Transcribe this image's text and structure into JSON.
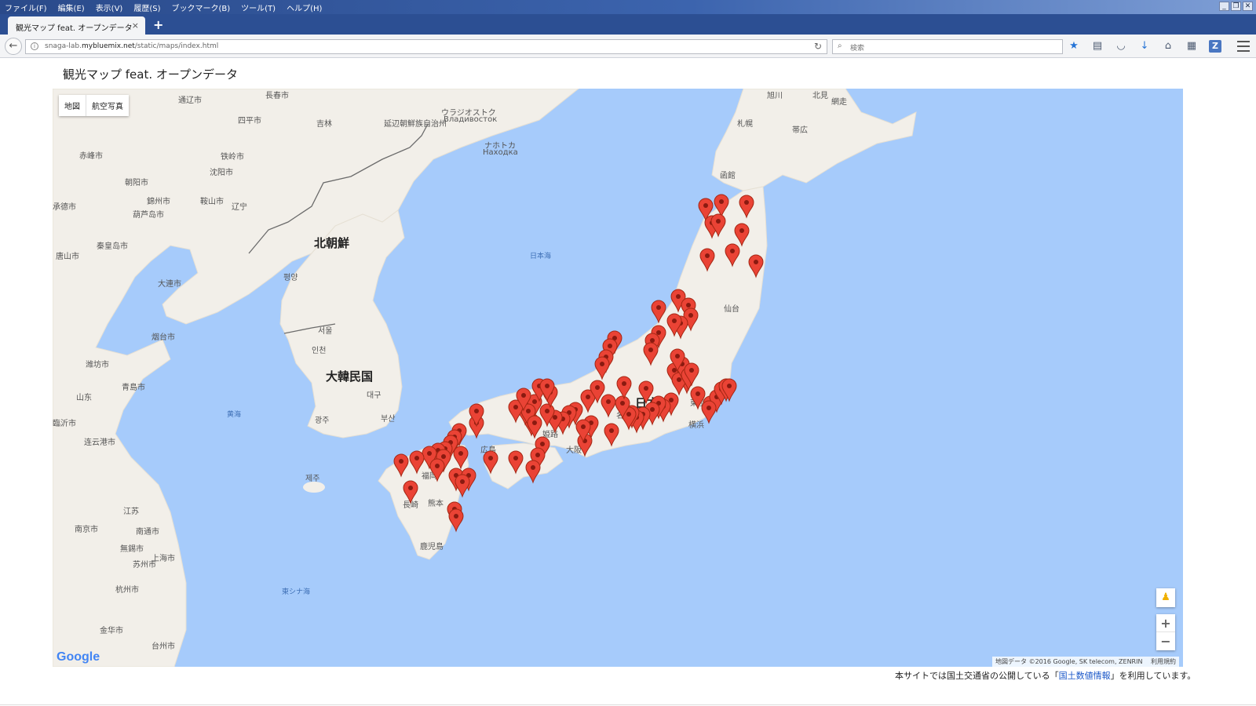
{
  "menubar": {
    "items": [
      "ファイル(F)",
      "編集(E)",
      "表示(V)",
      "履歴(S)",
      "ブックマーク(B)",
      "ツール(T)",
      "ヘルプ(H)"
    ]
  },
  "tab": {
    "title": "観光マップ feat. オープンデータ",
    "close": "×",
    "new": "+"
  },
  "navbar": {
    "back": "←",
    "url_prefix": "snaga-lab.",
    "url_host": "mybluemix.net",
    "url_path": "/static/maps/index.html",
    "search_placeholder": "検索"
  },
  "page": {
    "title": "観光マップ feat. オープンデータ"
  },
  "map": {
    "type_buttons": [
      "地図",
      "航空写真"
    ],
    "countries": [
      "北朝鮮",
      "大韓民国",
      "日本"
    ],
    "seas": [
      "日本海",
      "黄海",
      "東シナ海"
    ],
    "cities": [
      "長春市",
      "吉林",
      "通辽市",
      "四平市",
      "延辺朝鮮族自治州",
      "ウラジオストク",
      "Владивосток",
      "ナホトカ",
      "Находка",
      "赤峰市",
      "朝阳市",
      "铁岭市",
      "沈阳市",
      "錦州市",
      "鞍山市",
      "辽宁",
      "承德市",
      "葫芦岛市",
      "秦皇岛市",
      "唐山市",
      "大連市",
      "평양",
      "烟台市",
      "潍坊市",
      "青島市",
      "山东",
      "臨沂市",
      "连云港市",
      "서울",
      "인천",
      "대구",
      "광주",
      "부산",
      "제주",
      "江苏",
      "南京市",
      "無錫市",
      "南通市",
      "苏州市",
      "上海市",
      "杭州市",
      "金华市",
      "台州市",
      "旭川",
      "北見",
      "網走",
      "札幌",
      "帯広",
      "函館",
      "仙台",
      "東京",
      "横浜",
      "名古屋",
      "大阪",
      "姫路",
      "広島",
      "福岡",
      "長崎",
      "熊本",
      "鹿児島"
    ],
    "zoom_in": "+",
    "zoom_out": "−",
    "google": "Google",
    "attribution": "地図データ ©2016 Google, SK telecom, ZENRIN",
    "terms": "利用規約"
  },
  "footer": {
    "before": "本サイトでは国土交通省の公開している「",
    "link": "国土数値情報",
    "after": "」を利用しています。"
  },
  "colors": {
    "water": "#a6cbfb",
    "land": "#f2efe9",
    "marker": "#ea4335"
  }
}
